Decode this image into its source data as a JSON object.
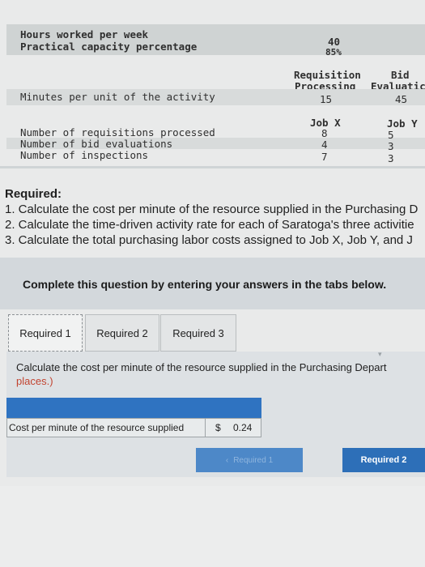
{
  "data_table": {
    "hours_label": "Hours worked per week",
    "hours_value": "40",
    "capacity_label": "Practical capacity percentage",
    "capacity_value": "85%",
    "activity_headers": {
      "requisition_line1": "Requisition",
      "requisition_line2": "Processing",
      "bid_line1": "Bid",
      "bid_line2": "Evaluatic"
    },
    "minutes_label": "Minutes per unit of the activity",
    "minutes_requisition": "15",
    "minutes_bid": "45",
    "job_headers": {
      "job_x": "Job X",
      "job_y": "Job Y"
    },
    "rows": [
      {
        "label": "Number of requisitions processed",
        "job_x": "8",
        "job_y": "5"
      },
      {
        "label": "Number of bid evaluations",
        "job_x": "4",
        "job_y": "3"
      },
      {
        "label": "Number of inspections",
        "job_x": "7",
        "job_y": "3"
      }
    ]
  },
  "required": {
    "title": "Required:",
    "items": [
      "1. Calculate the cost per minute of the resource supplied in the Purchasing D",
      "2. Calculate the time-driven activity rate for each of Saratoga's three activitie",
      "3. Calculate the total purchasing labor costs assigned to Job X, Job Y, and J"
    ]
  },
  "instruction": "Complete this question by entering your answers in the tabs below.",
  "tabs": [
    {
      "label": "Required 1",
      "active": true
    },
    {
      "label": "Required 2",
      "active": false
    },
    {
      "label": "Required 3",
      "active": false
    }
  ],
  "panel": {
    "question_line1": "Calculate the cost per minute of the resource supplied in the Purchasing Depart",
    "question_line2": "places.)"
  },
  "answer": {
    "label": "Cost per minute of the resource supplied",
    "currency": "$",
    "value": "0.24"
  },
  "nav": {
    "prev_label": "Required 1",
    "next_label": "Required 2"
  },
  "colors": {
    "accent_blue": "#2f73c1",
    "button_blue": "#2d6fb8",
    "question_highlight": "#c24430"
  }
}
